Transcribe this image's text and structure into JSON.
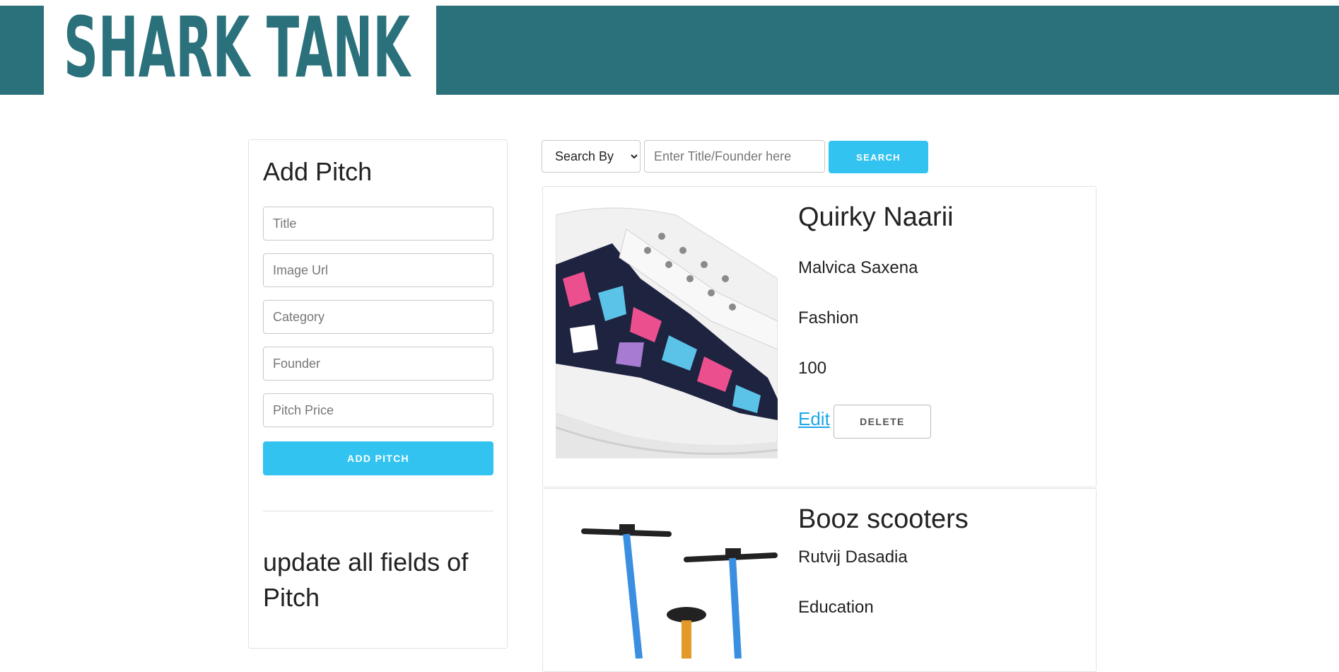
{
  "header": {
    "logo_text": "SHARK TANK",
    "brand_color": "#2a717c"
  },
  "add_form": {
    "title": "Add Pitch",
    "fields": [
      {
        "placeholder": "Title",
        "value": ""
      },
      {
        "placeholder": "Image Url",
        "value": ""
      },
      {
        "placeholder": "Category",
        "value": ""
      },
      {
        "placeholder": "Founder",
        "value": ""
      },
      {
        "placeholder": "Pitch Price",
        "value": ""
      }
    ],
    "submit_label": "ADD PITCH"
  },
  "update_section": {
    "title": "update all fields of Pitch"
  },
  "search": {
    "select_value": "Search By",
    "placeholder": "Enter Title/Founder here",
    "button_label": "SEARCH",
    "accent_color": "#33c3f0"
  },
  "pitches": [
    {
      "title": "Quirky Naarii",
      "founder": "Malvica Saxena",
      "category": "Fashion",
      "price": "100",
      "image": "sneaker-image",
      "edit_label": "Edit",
      "delete_label": "DELETE"
    },
    {
      "title": "Booz scooters",
      "founder": "Rutvij Dasadia",
      "category": "Education",
      "image": "scooter-image"
    }
  ]
}
